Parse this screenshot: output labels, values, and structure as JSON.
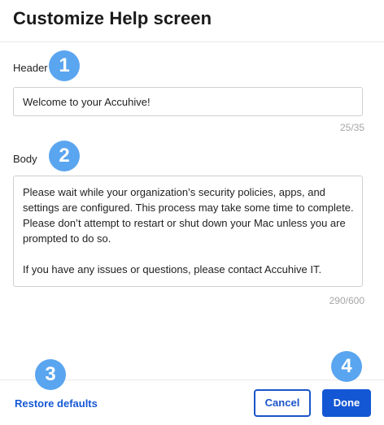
{
  "dialog": {
    "title": "Customize Help screen"
  },
  "header_field": {
    "label": "Header",
    "value": "Welcome to your Accuhive!",
    "counter": "25/35",
    "badge": "1"
  },
  "body_field": {
    "label": "Body",
    "lines": [
      "Please wait while your organization’s security policies, apps, and",
      "settings are configured. This process may take some time to complete.",
      "Please don’t attempt to restart or shut down your Mac unless you are",
      "prompted to do so.",
      "If you have any issues or questions, please contact Accuhive IT."
    ],
    "counter": "290/600",
    "badge": "2"
  },
  "footer": {
    "restore_label": "Restore defaults",
    "restore_badge": "3",
    "cancel_label": "Cancel",
    "done_label": "Done",
    "done_badge": "4"
  },
  "colors": {
    "badge": "#5aa5ef",
    "primary": "#1457d4",
    "link": "#1558d6"
  }
}
